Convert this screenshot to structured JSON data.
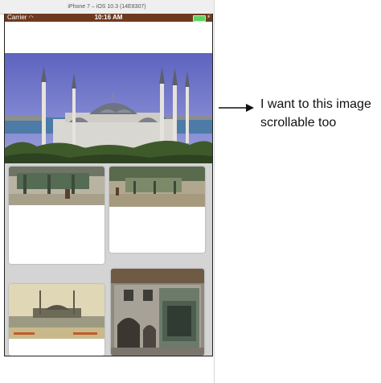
{
  "simulator": {
    "title": "iPhone 7 – iOS 10.3 (14E8307)"
  },
  "status_bar": {
    "carrier": "Carrier",
    "time": "10:16 AM"
  },
  "annotation": {
    "line1": "I want to this image",
    "line2": "scrollable too"
  },
  "colors": {
    "status_bar": "#6e3a1f",
    "sky": "#6a6fc2",
    "battery": "#5fd35f"
  },
  "icons": [
    "wifi-icon",
    "battery-icon",
    "charge-icon",
    "right-arrow-icon"
  ]
}
